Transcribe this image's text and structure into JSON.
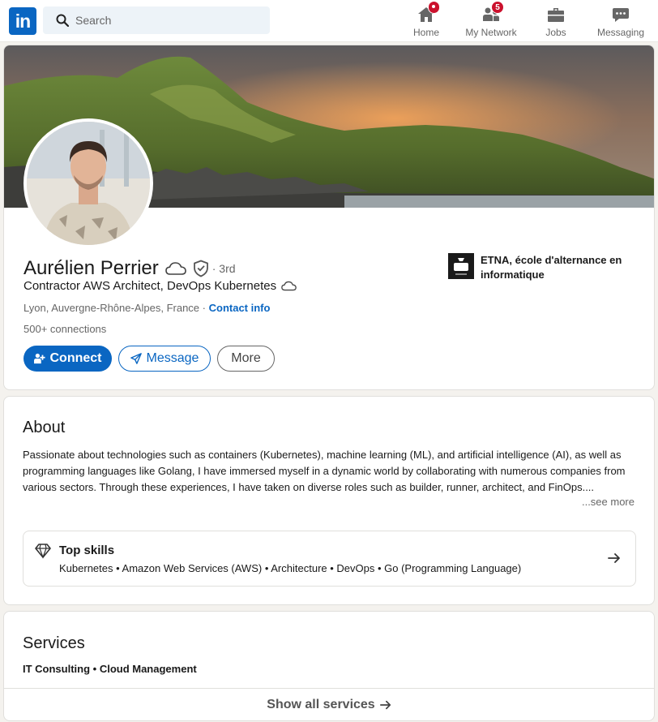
{
  "nav": {
    "logo_text": "in",
    "search_placeholder": "Search",
    "items": [
      {
        "label": "Home",
        "icon": "home-icon",
        "badge": ""
      },
      {
        "label": "My Network",
        "icon": "network-icon",
        "badge": "5"
      },
      {
        "label": "Jobs",
        "icon": "briefcase-icon",
        "badge": ""
      },
      {
        "label": "Messaging",
        "icon": "messaging-icon",
        "badge": ""
      }
    ]
  },
  "profile": {
    "name": "Aurélien Perrier",
    "degree": "· 3rd",
    "headline": "Contractor AWS Architect, DevOps Kubernetes",
    "location": "Lyon, Auvergne-Rhône-Alpes, France",
    "location_sep": " · ",
    "contact_info": "Contact info",
    "connections": "500+ connections",
    "buttons": {
      "connect": "Connect",
      "message": "Message",
      "more": "More"
    },
    "company": {
      "name": "ETNA, école d'alternance en informatique",
      "logo_text": "etna"
    }
  },
  "about": {
    "title": "About",
    "text": "Passionate about technologies such as containers (Kubernetes), machine learning (ML), and artificial intelligence (AI), as well as programming languages like Golang, I have immersed myself in a dynamic world by collaborating with numerous companies from various sectors. Through these experiences, I have taken on diverse roles such as builder, runner, architect, and FinOps....",
    "see_more": "...see more",
    "top_skills": {
      "title": "Top skills",
      "list": "Kubernetes • Amazon Web Services (AWS) • Architecture • DevOps • Go (Programming Language)"
    }
  },
  "services": {
    "title": "Services",
    "list": "IT Consulting • Cloud Management",
    "show_all": "Show all services"
  },
  "colors": {
    "brand": "#0a66c2",
    "badge": "#cb112d",
    "page_bg": "#f4f2ee"
  }
}
